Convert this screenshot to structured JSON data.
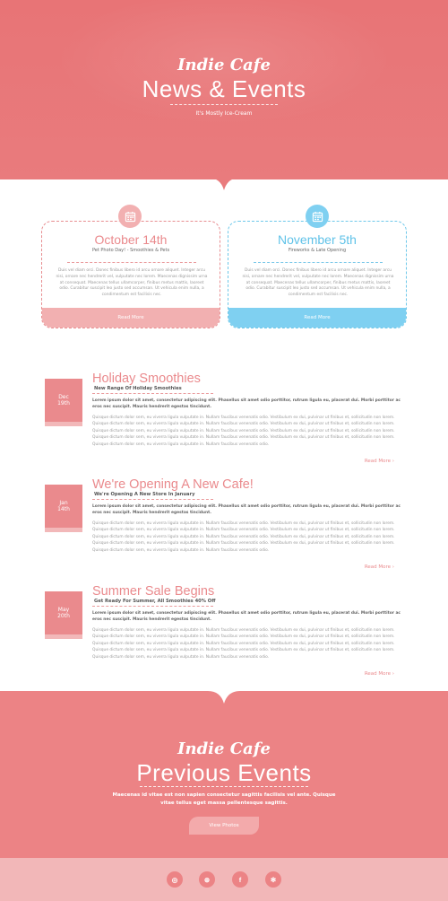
{
  "hero": {
    "brand": "Indie Cafe",
    "title": "News & Events",
    "tagline": "It's Mostly Ice-Cream"
  },
  "events": [
    {
      "date": "October 14th",
      "subtitle": "Pet Photo Day! - Smoothies & Pets",
      "body": "Duis vel diam orci. Donec finibus libero id arcu ornare aliquet. Integer arcu nisi, ornare nec hendrerit vel, vulputate nec lorem. Maecenas dignissim urna at consequat. Maecenas tellus ullamcorper, finibus metus mattis, laoreet odio. Curabitur suscipit leo justo sed accumsan. Ut vehicula enim nulla, a condimentum est facilisis nec.",
      "button": "Read More",
      "icon": "calendar-icon",
      "color": "#f2b0b1"
    },
    {
      "date": "November 5th",
      "subtitle": "Fireworks & Late Opening",
      "body": "Duis vel diam orci. Donec finibus libero id arcu ornare aliquet. Integer arcu nisi, ornare nec hendrerit vel, vulputate nec lorem. Maecenas dignissim urna at consequat. Maecenas tellus ullamcorper, finibus metus mattis, laoreet odio. Curabitur suscipit leo justo sed accumsan. Ut vehicula enim nulla, a condimentum est facilisis nec.",
      "button": "Read More",
      "icon": "calendar-icon",
      "color": "#7fd0f1"
    }
  ],
  "posts": [
    {
      "month": "Dec",
      "day": "19th",
      "title": "Holiday Smoothies",
      "subtitle": "New Range Of Holiday Smoothies",
      "lead": "Lorem ipsum dolor sit amet, consectetur adipiscing elit. Phasellus sit amet odio porttitor, rutrum ligula eu, placerat dui. Morbi porttitor ac eros nec suscipit. Mauris hendrerit egestas tincidunt.",
      "text": "Quisque dictum dolor sem, eu viverra ligula vulputate in. Nullam faucibus venenatis odio. Vestibulum ex dui, pulvinar ut finibus et, sollicitudin non lorem. Quisque dictum dolor sem, eu viverra ligula vulputate in. Nullam faucibus venenatis odio. Vestibulum ex dui, pulvinar ut finibus et, sollicitudin non lorem. Quisque dictum dolor sem, eu viverra ligula vulputate in. Nullam faucibus venenatis odio. Vestibulum ex dui, pulvinar ut finibus et, sollicitudin non lorem. Quisque dictum dolor sem, eu viverra ligula vulputate in. Nullam faucibus venenatis odio. Vestibulum ex dui, pulvinar ut finibus et, sollicitudin non lorem. Quisque dictum dolor sem, eu viverra ligula vulputate in. Nullam faucibus venenatis odio.",
      "more": "Read More"
    },
    {
      "month": "Jan",
      "day": "14th",
      "title": "We're Opening A New Cafe!",
      "subtitle": "We're Opening A New Store In January",
      "lead": "Lorem ipsum dolor sit amet, consectetur adipiscing elit. Phasellus sit amet odio porttitor, rutrum ligula eu, placerat dui. Morbi porttitor ac eros nec suscipit. Mauris hendrerit egestas tincidunt.",
      "text": "Quisque dictum dolor sem, eu viverra ligula vulputate in. Nullam faucibus venenatis odio. Vestibulum ex dui, pulvinar ut finibus et, sollicitudin non lorem. Quisque dictum dolor sem, eu viverra ligula vulputate in. Nullam faucibus venenatis odio. Vestibulum ex dui, pulvinar ut finibus et, sollicitudin non lorem. Quisque dictum dolor sem, eu viverra ligula vulputate in. Nullam faucibus venenatis odio. Vestibulum ex dui, pulvinar ut finibus et, sollicitudin non lorem. Quisque dictum dolor sem, eu viverra ligula vulputate in. Nullam faucibus venenatis odio. Vestibulum ex dui, pulvinar ut finibus et, sollicitudin non lorem. Quisque dictum dolor sem, eu viverra ligula vulputate in. Nullam faucibus venenatis odio.",
      "more": "Read More"
    },
    {
      "month": "May",
      "day": "20th",
      "title": "Summer Sale Begins",
      "subtitle": "Get Ready For Summer, All Smoothies 40% Off",
      "lead": "Lorem ipsum dolor sit amet, consectetur adipiscing elit. Phasellus sit amet odio porttitor, rutrum ligula eu, placerat dui. Morbi porttitor ac eros nec suscipit. Mauris hendrerit egestas tincidunt.",
      "text": "Quisque dictum dolor sem, eu viverra ligula vulputate in. Nullam faucibus venenatis odio. Vestibulum ex dui, pulvinar ut finibus et, sollicitudin non lorem. Quisque dictum dolor sem, eu viverra ligula vulputate in. Nullam faucibus venenatis odio. Vestibulum ex dui, pulvinar ut finibus et, sollicitudin non lorem. Quisque dictum dolor sem, eu viverra ligula vulputate in. Nullam faucibus venenatis odio. Vestibulum ex dui, pulvinar ut finibus et, sollicitudin non lorem. Quisque dictum dolor sem, eu viverra ligula vulputate in. Nullam faucibus venenatis odio. Vestibulum ex dui, pulvinar ut finibus et, sollicitudin non lorem. Quisque dictum dolor sem, eu viverra ligula vulputate in. Nullam faucibus venenatis odio.",
      "more": "Read More"
    }
  ],
  "footer": {
    "brand": "Indie Cafe",
    "title": "Previous Events",
    "description": "Maecenas id vitae est non sapien consectetur sagittis facilisis vel ante. Quisque vitae tellus eget massa pellentesque sagittis.",
    "button": "View Photos"
  },
  "social": [
    {
      "icon": "instagram-icon",
      "glyph": "◎"
    },
    {
      "icon": "dribbble-icon",
      "glyph": "⊛"
    },
    {
      "icon": "facebook-icon",
      "glyph": "f"
    },
    {
      "icon": "yelp-icon",
      "glyph": "✻"
    }
  ],
  "colors": {
    "primary": "#ea8a8d",
    "primary_light": "#f2b0b1",
    "accent_blue": "#7fd0f1",
    "hero_bg": "#e87476"
  }
}
